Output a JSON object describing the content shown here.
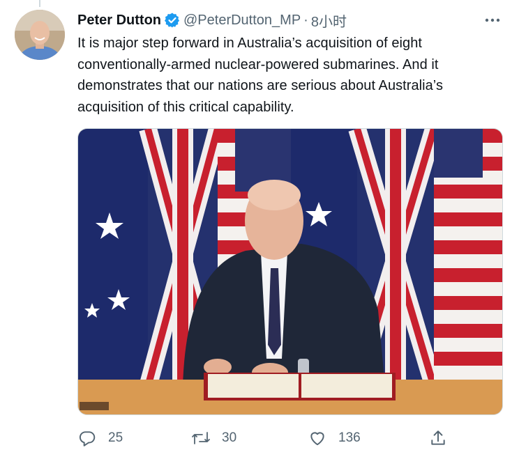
{
  "tweet": {
    "author_name": "Peter Dutton",
    "handle": "@PeterDutton_MP",
    "separator": "·",
    "timestamp": "8小时",
    "text": "It is major step forward in Australia’s acquisition of eight conventionally-armed nuclear-powered submarines. And it demonstrates that our nations are serious about Australia’s acquisition of this critical capability.",
    "verified": true,
    "accent_color": "#1d9bf0"
  },
  "actions": {
    "reply_count": "25",
    "retweet_count": "30",
    "like_count": "136"
  },
  "icons": [
    "verified-badge-icon",
    "more-icon",
    "reply-icon",
    "retweet-icon",
    "like-icon",
    "share-icon"
  ]
}
